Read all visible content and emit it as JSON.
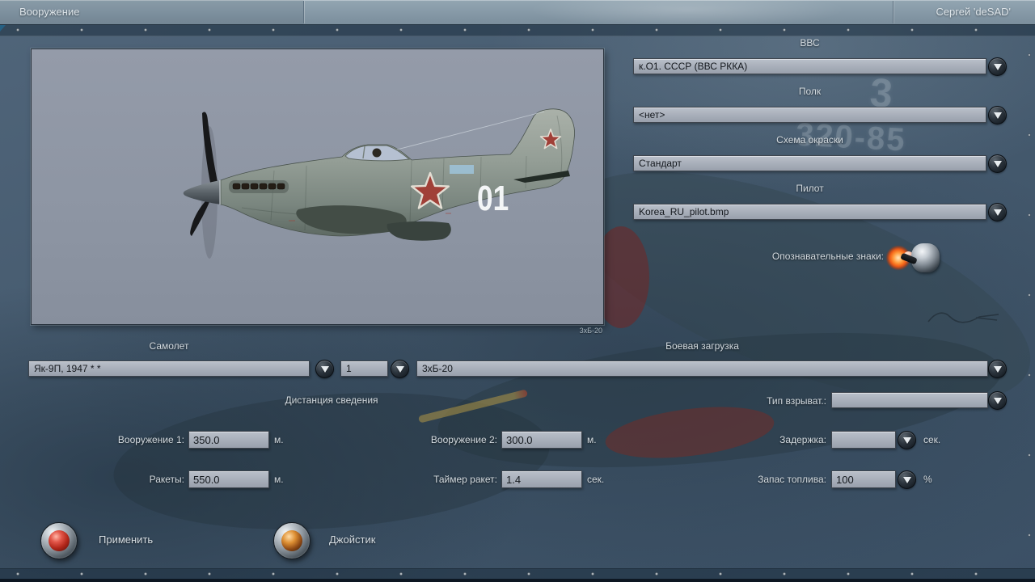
{
  "header": {
    "tab_label": "Вооружение",
    "player_name": "Сергей 'deSAD'"
  },
  "viewer": {
    "tactical_number": "01",
    "caption": "3хБ-20"
  },
  "selectors": {
    "airforce": {
      "label": "ВВС",
      "value": "к.О1. СССР (ВВС РККА)"
    },
    "regiment": {
      "label": "Полк",
      "value": "<нет>"
    },
    "paint_scheme": {
      "label": "Схема окраски",
      "value": "Стандарт"
    },
    "pilot": {
      "label": "Пилот",
      "value": "Korea_RU_pilot.bmp"
    },
    "markings_label": "Опознавательные знаки:"
  },
  "aircraft_row": {
    "aircraft_label": "Самолет",
    "aircraft_value": "Як-9П, 1947 * *",
    "count_value": "1",
    "loadout_label": "Боевая загрузка",
    "loadout_value": "3хБ-20"
  },
  "convergence": {
    "title": "Дистанция сведения",
    "weapon1": {
      "label": "Вооружение 1:",
      "value": "350.0",
      "unit": "м."
    },
    "weapon2": {
      "label": "Вооружение 2:",
      "value": "300.0",
      "unit": "м."
    },
    "rockets": {
      "label": "Ракеты:",
      "value": "550.0",
      "unit": "м."
    },
    "rocket_timer": {
      "label": "Таймер ракет:",
      "value": "1.4",
      "unit": "сек."
    }
  },
  "fuse": {
    "type": {
      "label": "Тип взрыват.:",
      "value": ""
    },
    "delay": {
      "label": "Задержка:",
      "value": "",
      "unit": "сек."
    },
    "fuel": {
      "label": "Запас топлива:",
      "value": "100",
      "unit": "%"
    }
  },
  "actions": {
    "apply_label": "Применить",
    "joystick_label": "Джойстик"
  },
  "background_markings": {
    "numeral": "3",
    "code": "320-85"
  },
  "colors": {
    "star_red": "#a84038",
    "panel_gray": "#8e96a4",
    "control_gray": "#a9afbb",
    "bg_slate": "#44566a",
    "glow_orange": "#ff7a1e"
  }
}
